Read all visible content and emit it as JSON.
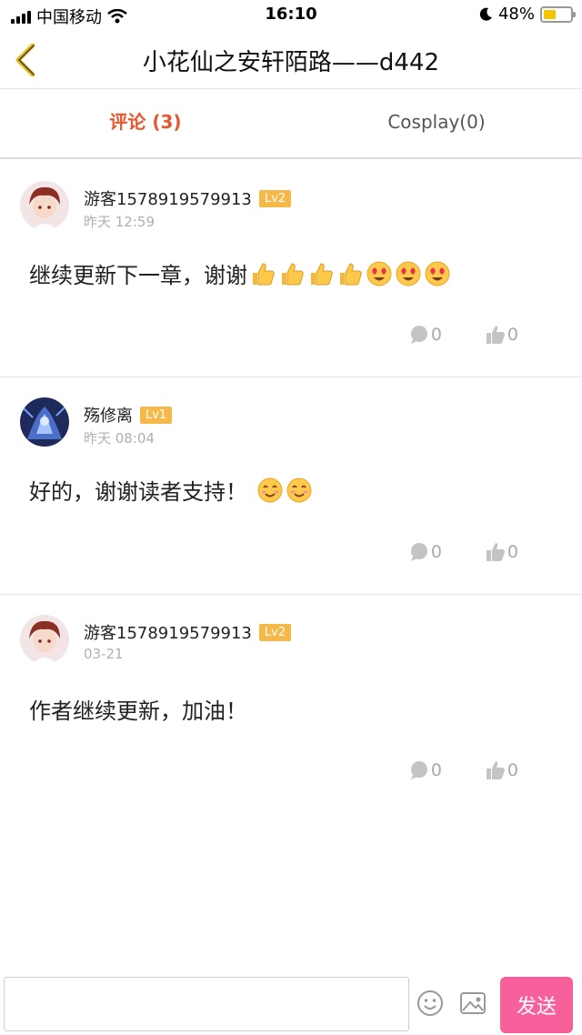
{
  "status_bar": {
    "carrier": "中国移动",
    "time": "16:10",
    "battery": "48%"
  },
  "nav": {
    "title": "小花仙之安轩陌路——d442",
    "back_icon": "chevron-left-icon"
  },
  "tabs": [
    {
      "label": "评论 (3)",
      "active": true
    },
    {
      "label": "Cosplay(0)",
      "active": false
    }
  ],
  "comments": [
    {
      "username": "游客1578919579913",
      "level": "Lv2",
      "time": "昨天 12:59",
      "text": "继续更新下一章，谢谢",
      "emojis": [
        "👍",
        "👍",
        "👍",
        "👍",
        "😍",
        "😍",
        "😍"
      ],
      "reply_count": "0",
      "like_count": "0"
    },
    {
      "username": "殇修离",
      "level": "Lv1",
      "time": "昨天 08:04",
      "text": "好的，谢谢读者支持！",
      "emojis": [
        "😊",
        "😊"
      ],
      "reply_count": "0",
      "like_count": "0"
    },
    {
      "username": "游客1578919579913",
      "level": "Lv2",
      "time": "03-21",
      "text": "作者继续更新，加油！",
      "emojis": [],
      "reply_count": "0",
      "like_count": "0"
    }
  ],
  "bottom_bar": {
    "input_value": "",
    "input_placeholder": "",
    "send_label": "发送"
  },
  "colors": {
    "accent": "#e4572e",
    "send": "#f7609a",
    "badge": "#f5b849"
  }
}
